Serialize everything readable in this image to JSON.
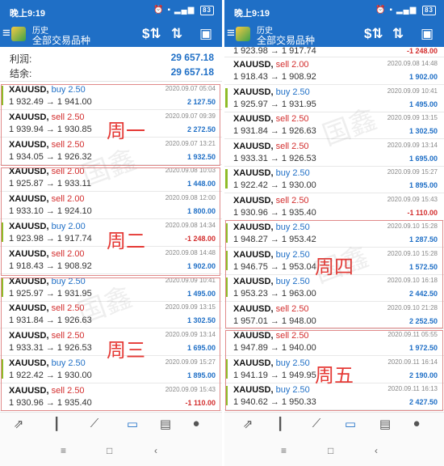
{
  "status": {
    "time": "晚上9:19",
    "icons": "⏰ ▪ ▂▄▆ ",
    "battery": "83"
  },
  "appbar": {
    "title_small": "历史",
    "title_main": "全部交易品种"
  },
  "icons": {
    "menu": "menu-icon",
    "dollar": "dollar-sort-icon",
    "sort": "sort-icon",
    "calendar": "calendar-icon"
  },
  "summary": {
    "profit_label": "利润:",
    "profit_value": "29 657.18",
    "balance_label": "结余:",
    "balance_value": "29 657.18"
  },
  "left_trades": [
    {
      "symbol": "XAUUSD,",
      "side": "buy 2.50",
      "prices": "1 932.49 → 1 941.00",
      "date": "2020.09.07 05:04",
      "pl": "2 127.50"
    },
    {
      "symbol": "XAUUSD,",
      "side": "sell 2.50",
      "prices": "1 939.94 → 1 930.85",
      "date": "2020.09.07 09:39",
      "pl": "2 272.50"
    },
    {
      "symbol": "XAUUSD,",
      "side": "sell 2.50",
      "prices": "1 934.05 → 1 926.32",
      "date": "2020.09.07 13:21",
      "pl": "1 932.50"
    },
    {
      "symbol": "XAUUSD,",
      "side": "sell 2.00",
      "prices": "1 925.87 → 1 933.11",
      "date": "2020.09.08 10:03",
      "pl": "1 448.00"
    },
    {
      "symbol": "XAUUSD,",
      "side": "sell 2.00",
      "prices": "1 933.10 → 1 924.10",
      "date": "2020.09.08 12:00",
      "pl": "1 800.00"
    },
    {
      "symbol": "XAUUSD,",
      "side": "buy 2.00",
      "prices": "1 923.98 → 1 917.74",
      "date": "2020.09.08 14:34",
      "pl": "-1 248.00"
    },
    {
      "symbol": "XAUUSD,",
      "side": "sell 2.00",
      "prices": "1 918.43 → 1 908.92",
      "date": "2020.09.08 14:48",
      "pl": "1 902.00"
    },
    {
      "symbol": "XAUUSD,",
      "side": "buy 2.50",
      "prices": "1 925.97 → 1 931.95",
      "date": "2020.09.09 10:41",
      "pl": "1 495.00"
    },
    {
      "symbol": "XAUUSD,",
      "side": "sell 2.50",
      "prices": "1 931.84 → 1 926.63",
      "date": "2020.09.09 13:15",
      "pl": "1 302.50"
    },
    {
      "symbol": "XAUUSD,",
      "side": "sell 2.50",
      "prices": "1 933.31 → 1 926.53",
      "date": "2020.09.09 13:14",
      "pl": "1 695.00"
    },
    {
      "symbol": "XAUUSD,",
      "side": "buy 2.50",
      "prices": "1 922.42 → 1 930.00",
      "date": "2020.09.09 15:27",
      "pl": "1 895.00"
    },
    {
      "symbol": "XAUUSD,",
      "side": "sell 2.50",
      "prices": "1 930.96 → 1 935.40",
      "date": "2020.09.09 15:43",
      "pl": "-1 110.00"
    }
  ],
  "right_top": {
    "prices": "1 923.98 → 1 917.74",
    "pl": "-1 248.00"
  },
  "right_trades": [
    {
      "symbol": "XAUUSD,",
      "side": "sell 2.00",
      "prices": "1 918.43 → 1 908.92",
      "date": "2020.09.08 14:48",
      "pl": "1 902.00"
    },
    {
      "symbol": "XAUUSD,",
      "side": "buy 2.50",
      "prices": "1 925.97 → 1 931.95",
      "date": "2020.09.09 10:41",
      "pl": "1 495.00"
    },
    {
      "symbol": "XAUUSD,",
      "side": "sell 2.50",
      "prices": "1 931.84 → 1 926.63",
      "date": "2020.09.09 13:15",
      "pl": "1 302.50"
    },
    {
      "symbol": "XAUUSD,",
      "side": "sell 2.50",
      "prices": "1 933.31 → 1 926.53",
      "date": "2020.09.09 13:14",
      "pl": "1 695.00"
    },
    {
      "symbol": "XAUUSD,",
      "side": "buy 2.50",
      "prices": "1 922.42 → 1 930.00",
      "date": "2020.09.09 15:27",
      "pl": "1 895.00"
    },
    {
      "symbol": "XAUUSD,",
      "side": "sell 2.50",
      "prices": "1 930.96 → 1 935.40",
      "date": "2020.09.09 15:43",
      "pl": "-1 110.00"
    },
    {
      "symbol": "XAUUSD,",
      "side": "buy 2.50",
      "prices": "1 948.27 → 1 953.42",
      "date": "2020.09.10 15:28",
      "pl": "1 287.50"
    },
    {
      "symbol": "XAUUSD,",
      "side": "buy 2.50",
      "prices": "1 946.75 → 1 953.04",
      "date": "2020.09.10 15:28",
      "pl": "1 572.50"
    },
    {
      "symbol": "XAUUSD,",
      "side": "buy 2.50",
      "prices": "1 953.23 → 1 963.00",
      "date": "2020.09.10 16:18",
      "pl": "2 442.50"
    },
    {
      "symbol": "XAUUSD,",
      "side": "sell 2.50",
      "prices": "1 957.01 → 1 948.00",
      "date": "2020.09.10 21:28",
      "pl": "2 252.50"
    },
    {
      "symbol": "XAUUSD,",
      "side": "sell 2.50",
      "prices": "1 947.89 → 1 940.00",
      "date": "2020.09.11 05:55",
      "pl": "1 972.50"
    },
    {
      "symbol": "XAUUSD,",
      "side": "buy 2.50",
      "prices": "1 941.19 → 1 949.95",
      "date": "2020.09.11 16:14",
      "pl": "2 190.00"
    },
    {
      "symbol": "XAUUSD,",
      "side": "buy 2.50",
      "prices": "1 940.62 → 1 950.33",
      "date": "2020.09.11 16:13",
      "pl": "2 427.50"
    }
  ],
  "weeks": {
    "mon": "周一",
    "tue": "周二",
    "wed": "周三",
    "thu": "周四",
    "fri": "周五"
  },
  "watermark": "国鑫",
  "tabs": [
    "trade-icon",
    "chart-icon",
    "trending-icon",
    "history-inbox-icon",
    "news-icon",
    "chat-icon"
  ],
  "nav": {
    "menu": "≡",
    "home": "□",
    "back": "‹"
  },
  "colors": {
    "primary": "#1f6fc6",
    "sell": "#d32f2f",
    "buy_bar": "#8fbc28",
    "week_red": "#e53935"
  }
}
